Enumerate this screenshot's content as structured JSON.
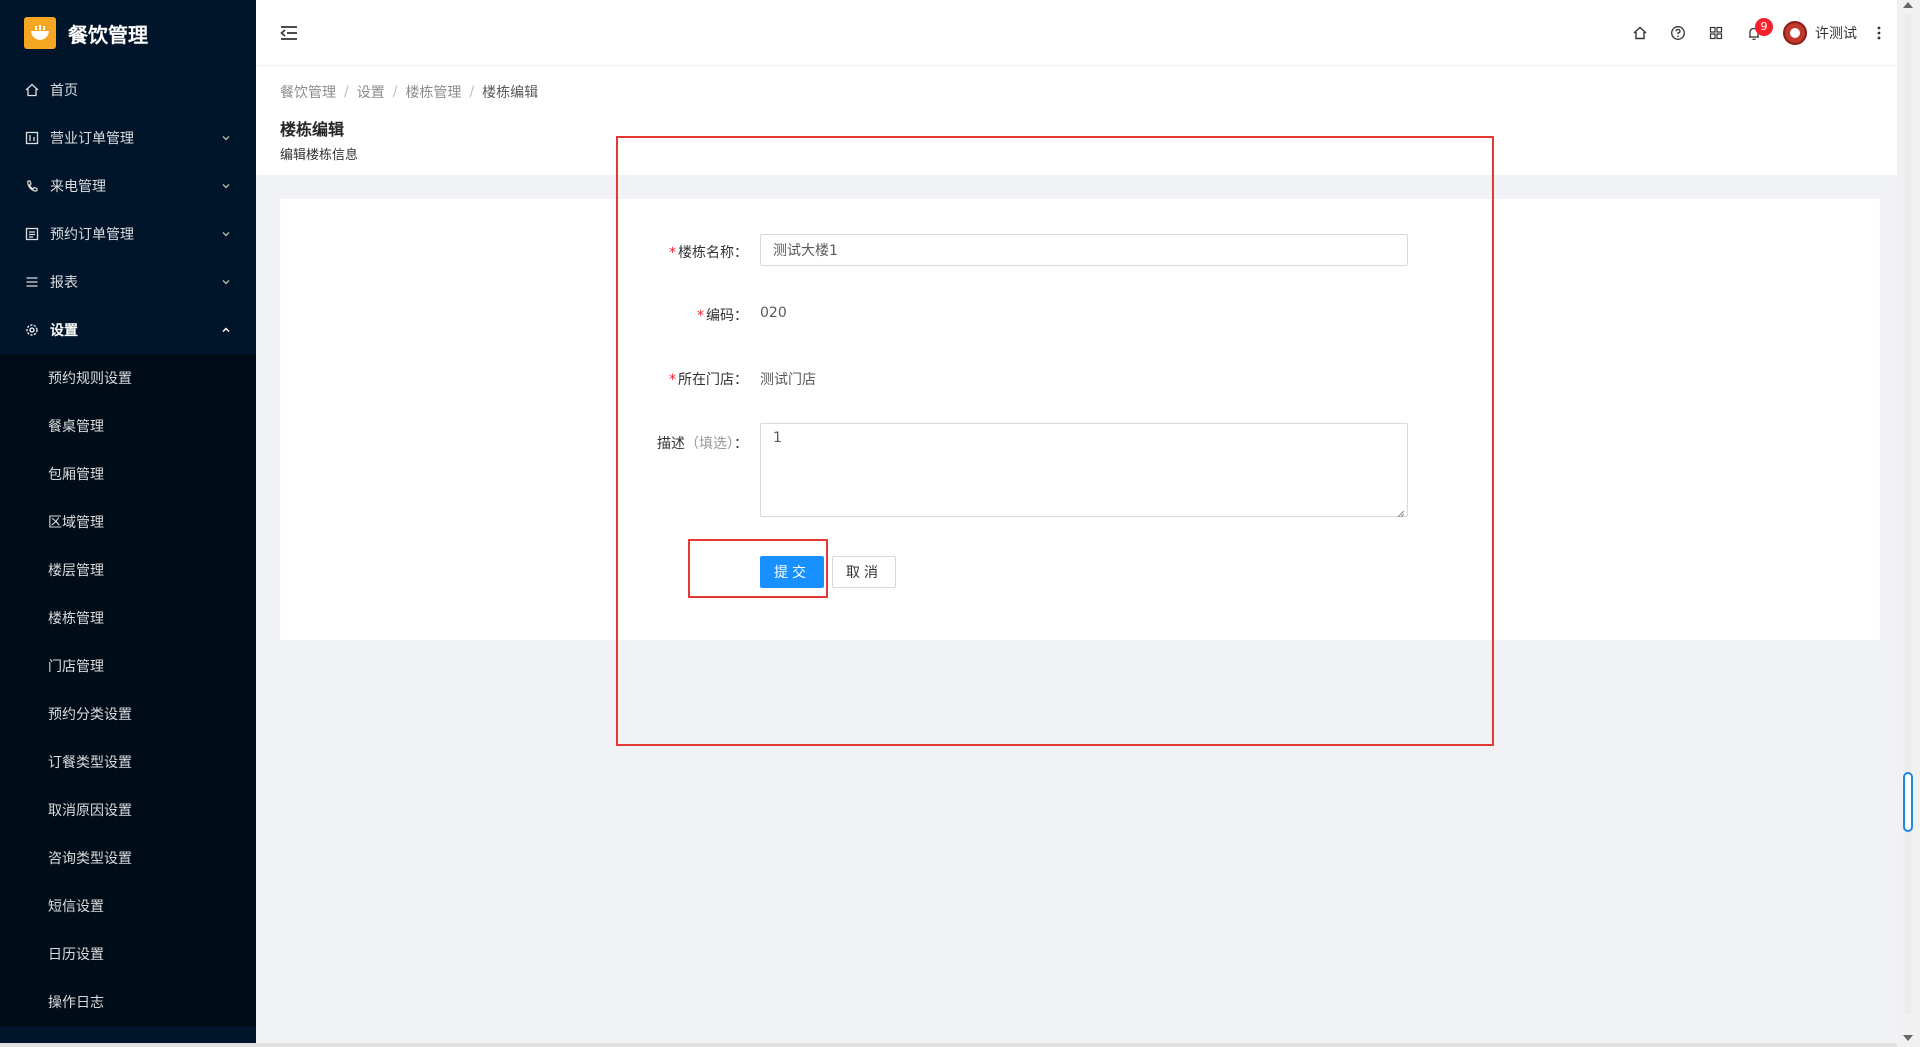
{
  "app": {
    "title": "餐饮管理"
  },
  "sidebar": {
    "items": [
      {
        "label": "首页",
        "icon": "home-icon",
        "has_arrow": false
      },
      {
        "label": "营业订单管理",
        "icon": "table-icon",
        "has_arrow": true
      },
      {
        "label": "来电管理",
        "icon": "phone-icon",
        "has_arrow": true
      },
      {
        "label": "预约订单管理",
        "icon": "order-icon",
        "has_arrow": true
      },
      {
        "label": "报表",
        "icon": "list-icon",
        "has_arrow": true
      },
      {
        "label": "设置",
        "icon": "gear-icon",
        "has_arrow": true,
        "open": true
      }
    ],
    "sub_items": [
      "预约规则设置",
      "餐桌管理",
      "包厢管理",
      "区域管理",
      "楼层管理",
      "楼栋管理",
      "门店管理",
      "预约分类设置",
      "订餐类型设置",
      "取消原因设置",
      "咨询类型设置",
      "短信设置",
      "日历设置",
      "操作日志"
    ]
  },
  "header": {
    "notification_count": "9",
    "username": "许测试"
  },
  "breadcrumb": [
    "餐饮管理",
    "设置",
    "楼栋管理",
    "楼栋编辑"
  ],
  "page": {
    "title": "楼栋编辑",
    "subtitle": "编辑楼栋信息"
  },
  "form": {
    "name_label": "楼栋名称",
    "name_value": "测试大楼1",
    "code_label": "编码",
    "code_value": "020",
    "store_label": "所在门店",
    "store_value": "测试门店",
    "desc_label": "描述",
    "desc_optional": "（填选）",
    "desc_value": "1",
    "colon": "：",
    "required_mark": "*",
    "submit_label": "提交",
    "cancel_label": "取消"
  },
  "colors": {
    "sidebar_bg": "#001529",
    "submenu_bg": "#000c17",
    "primary": "#1890ff",
    "annotation": "#e53935",
    "badge": "#f5222d"
  }
}
